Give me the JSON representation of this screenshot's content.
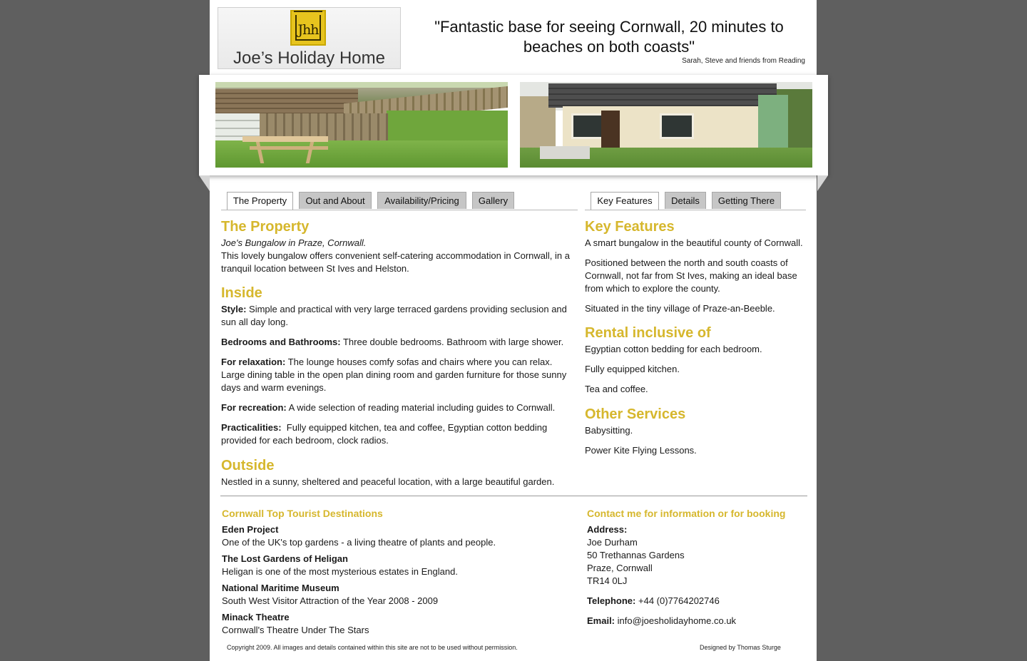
{
  "header": {
    "logo_mark": "Jhh",
    "logo_text": "Joe’s Holiday Home",
    "quote_line1": "\"Fantastic base for seeing Cornwall, 20 minutes to",
    "quote_line2": "beaches on both coasts\"",
    "quote_by": "Sarah, Steve and friends from Reading"
  },
  "tabs_left": [
    "The Property",
    "Out and About",
    "Availability/Pricing",
    "Gallery"
  ],
  "tabs_right": [
    "Key Features",
    "Details",
    "Getting There"
  ],
  "property": {
    "heading": "The Property",
    "subtitle": "Joe's Bungalow in Praze, Cornwall.",
    "intro": "This lovely bungalow offers convenient self-catering accommodation in Cornwall, in a tranquil location between St Ives and Helston.",
    "inside_heading": "Inside",
    "items": [
      {
        "label": "Style:",
        "text": "Simple and practical with very large terraced gardens providing seclusion and sun all day long."
      },
      {
        "label": "Bedrooms and Bathrooms:",
        "text": "Three double bedrooms. Bathroom with large shower."
      },
      {
        "label": "For relaxation:",
        "text": "The lounge houses comfy sofas and chairs where you can relax. Large dining table in the open plan dining room and garden furniture for those sunny days and warm evenings."
      },
      {
        "label": "For recreation:",
        "text": "A wide selection of reading material including guides to Cornwall."
      },
      {
        "label": "Practicalities:",
        "text": "Fully equipped kitchen, tea and coffee, Egyptian cotton bedding provided for each bedroom, clock radios."
      }
    ],
    "outside_heading": "Outside",
    "outside_text": "Nestled in a sunny, sheltered and peaceful location, with a large beautiful garden."
  },
  "features": {
    "heading": "Key Features",
    "paras": [
      "A smart bungalow in the beautiful county of Cornwall.",
      "Positioned between the north and south coasts of Cornwall, not far from St Ives, making an ideal base from which to explore the county.",
      "Situated in the tiny village of Praze-an-Beeble."
    ],
    "rental_heading": "Rental inclusive of",
    "rental": [
      "Egyptian cotton bedding for each bedroom.",
      "Fully equipped kitchen.",
      "Tea and coffee."
    ],
    "services_heading": "Other Services",
    "services": [
      "Babysitting.",
      "Power Kite Flying Lessons."
    ]
  },
  "destinations": {
    "heading": "Cornwall Top Tourist Destinations",
    "items": [
      {
        "name": "Eden Project",
        "desc": "One of the UK's top gardens - a living theatre of plants and people."
      },
      {
        "name": "The Lost Gardens of Heligan",
        "desc": "Heligan is one of the most mysterious estates in England."
      },
      {
        "name": "National Maritime Museum",
        "desc": "South West Visitor Attraction of the Year 2008 - 2009"
      },
      {
        "name": "Minack Theatre",
        "desc": "Cornwall's Theatre Under The Stars"
      }
    ]
  },
  "contact": {
    "heading": "Contact me for information or for booking",
    "address_label": "Address:",
    "address_lines": [
      "Joe Durham",
      "50 Trethannas Gardens",
      "Praze, Cornwall",
      "TR14 0LJ"
    ],
    "telephone_label": "Telephone:",
    "telephone": "+44 (0)7764202746",
    "email_label": "Email:",
    "email": "info@joesholidayhome.co.uk"
  },
  "footer": {
    "copyright": "Copyright 2009. All images and details contained within this site are not to be used without permission.",
    "designed_by": "Designed by Thomas Sturge"
  }
}
